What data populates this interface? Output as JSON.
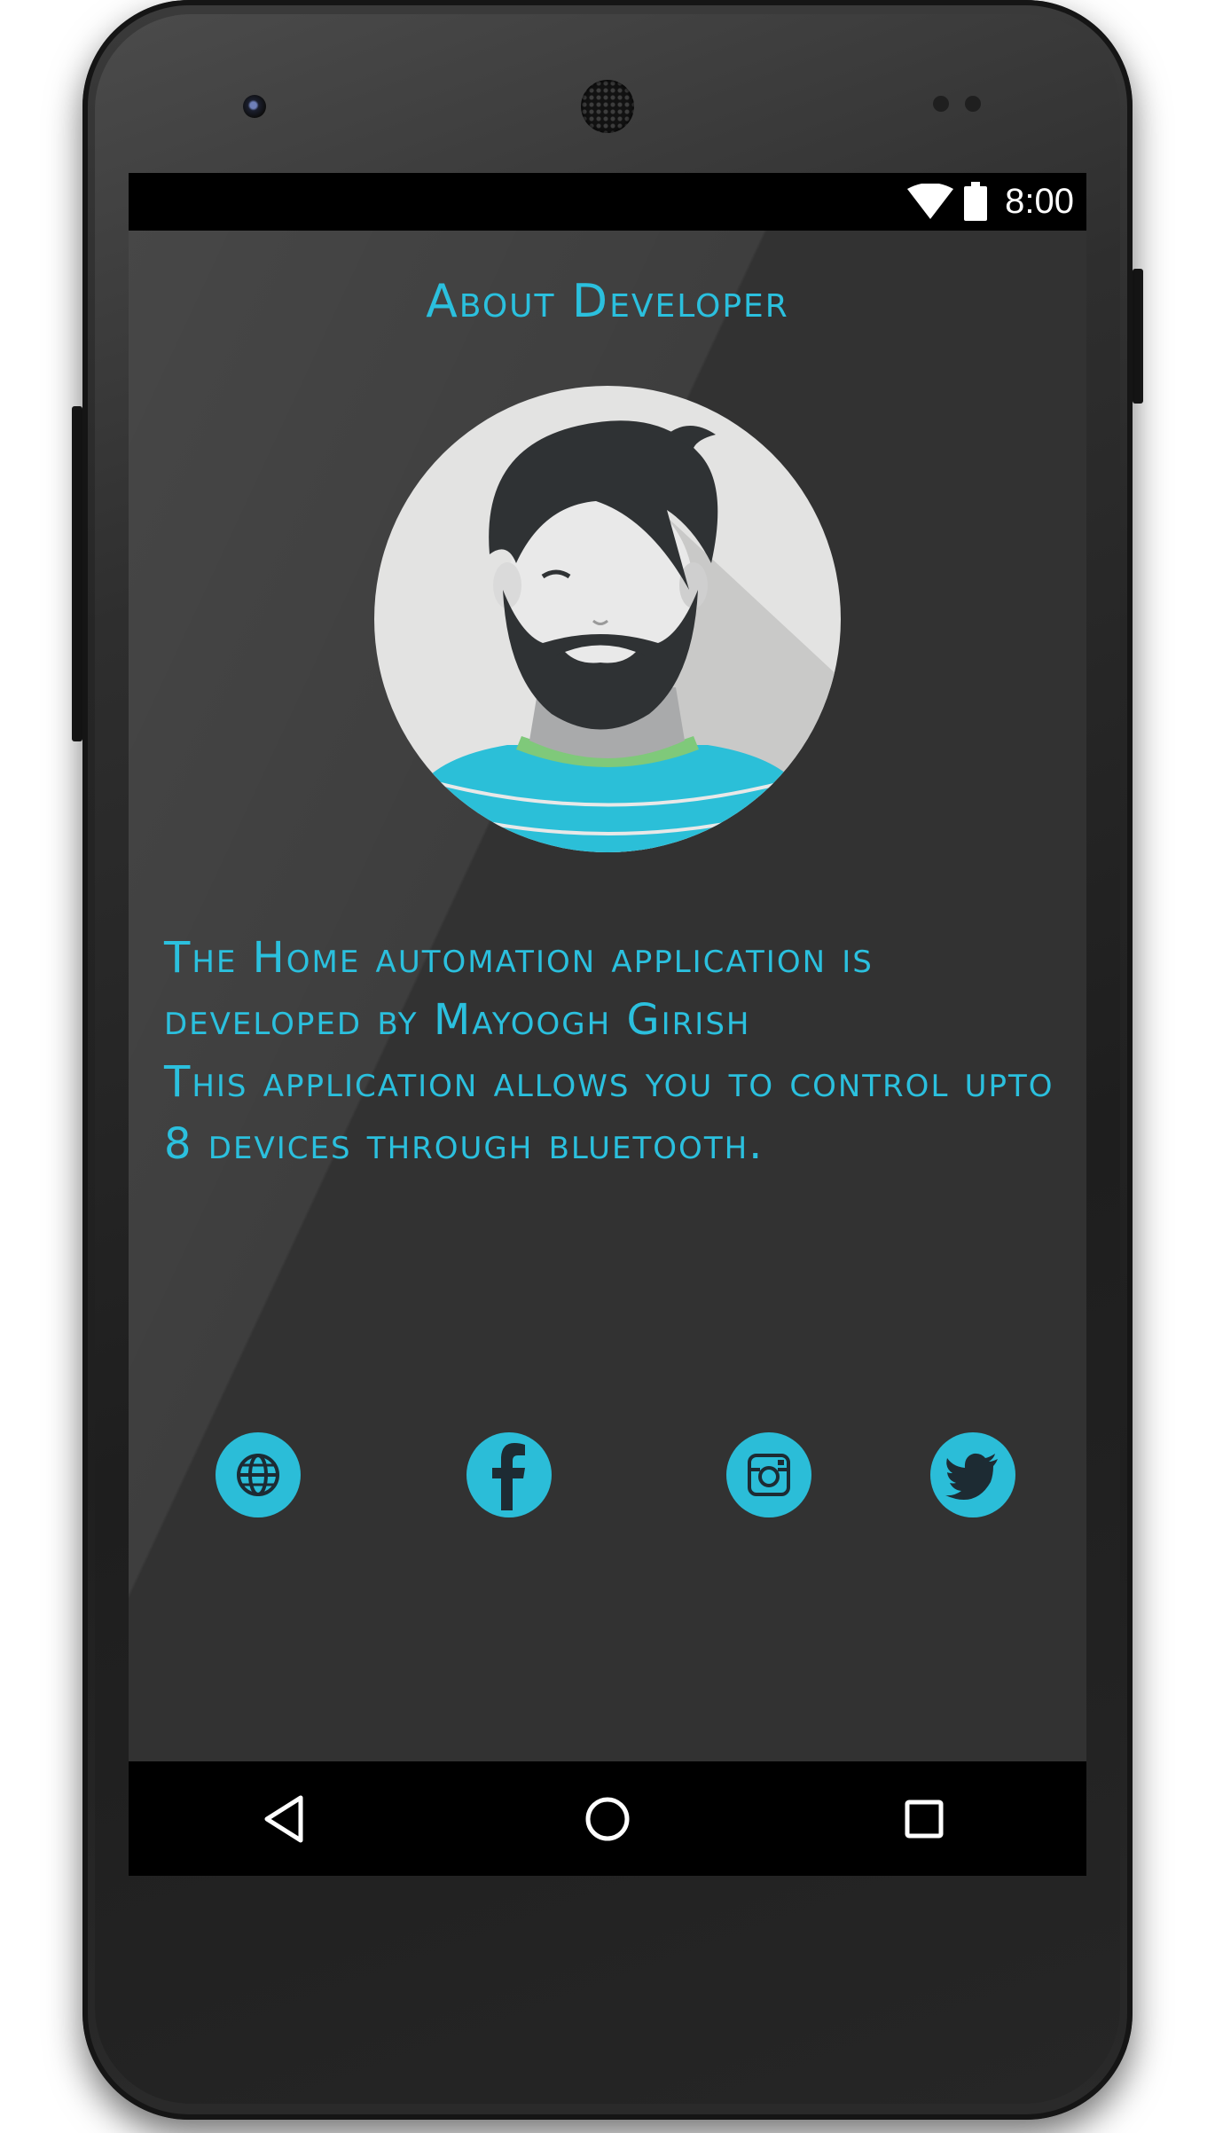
{
  "status_bar": {
    "time": "8:00",
    "wifi_icon": "wifi-icon",
    "battery_icon": "battery-icon"
  },
  "page": {
    "title": "About Developer",
    "avatar_icon": "bearded-developer-avatar",
    "description": "The Home automation application is developed by Mayoogh Girish\nThis application allows you to control upto 8 devices through bluetooth."
  },
  "social_links": [
    {
      "name": "website",
      "icon": "globe-icon"
    },
    {
      "name": "facebook",
      "icon": "facebook-icon"
    },
    {
      "name": "instagram",
      "icon": "instagram-icon"
    },
    {
      "name": "twitter",
      "icon": "twitter-icon"
    }
  ],
  "nav_bar": {
    "back_icon": "back-triangle-icon",
    "home_icon": "home-circle-icon",
    "recents_icon": "recents-square-icon"
  },
  "colors": {
    "accent": "#2bc0de",
    "screen_background": "#323232",
    "system_bars": "#000000"
  }
}
